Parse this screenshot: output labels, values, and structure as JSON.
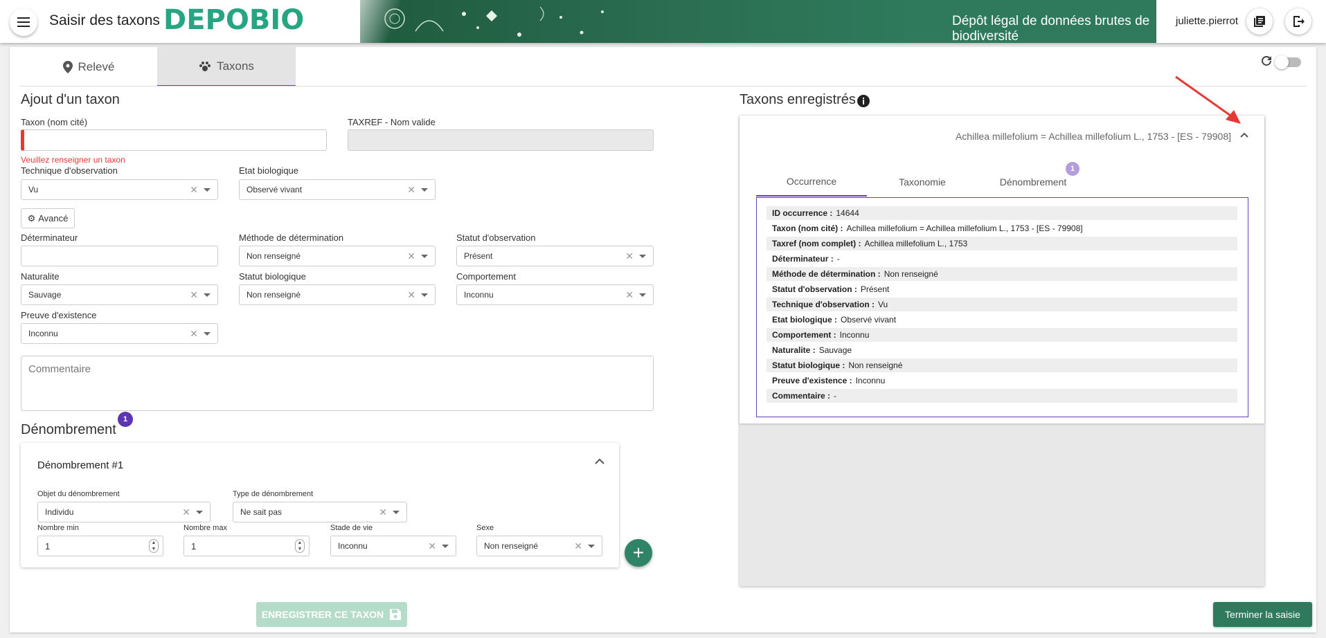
{
  "header": {
    "app_title": "Saisir des taxons",
    "logo_text": "DEPOBIO",
    "banner_title": "Dépôt légal de données brutes de biodiversité",
    "username": "juliette.pierrot",
    "menu_icon": "menu-icon",
    "docs_icon": "library-books-icon",
    "logout_icon": "logout-icon"
  },
  "tabs": [
    {
      "label": "Relevé",
      "icon": "map-marker-icon",
      "active": false
    },
    {
      "label": "Taxons",
      "icon": "paw-icon",
      "active": true
    }
  ],
  "form": {
    "section_title": "Ajout d'un taxon",
    "taxon_label": "Taxon (nom cité)",
    "taxon_value": "",
    "taxref_label": "TAXREF - Nom valide",
    "error_text": "Veuillez renseigner un taxon",
    "technique_label": "Technique d'observation",
    "technique_value": "Vu",
    "etat_label": "Etat biologique",
    "etat_value": "Observé vivant",
    "advanced_label": "Avancé",
    "determinateur_label": "Déterminateur",
    "methode_label": "Méthode de détermination",
    "methode_value": "Non renseigné",
    "statut_obs_label": "Statut d'observation",
    "statut_obs_value": "Présent",
    "naturalite_label": "Naturalite",
    "naturalite_value": "Sauvage",
    "statut_bio_label": "Statut biologique",
    "statut_bio_value": "Non renseigné",
    "comportement_label": "Comportement",
    "comportement_value": "Inconnu",
    "preuve_label": "Preuve d'existence",
    "preuve_value": "Inconnu",
    "comment_placeholder": "Commentaire"
  },
  "denombrement": {
    "section_title": "Dénombrement",
    "badge": "1",
    "card_title": "Dénombrement #1",
    "objet_label": "Objet du dénombrement",
    "objet_value": "Individu",
    "type_label": "Type de dénombrement",
    "type_value": "Ne sait pas",
    "min_label": "Nombre min",
    "min_value": "1",
    "max_label": "Nombre max",
    "max_value": "1",
    "stade_label": "Stade de vie",
    "stade_value": "Inconnu",
    "sexe_label": "Sexe",
    "sexe_value": "Non renseigné"
  },
  "actions": {
    "save_label": "ENREGISTRER CE TAXON",
    "finish_label": "Terminer la saisie"
  },
  "registered": {
    "title": "Taxons enregistrés",
    "taxon_header": "Achillea millefolium = Achillea millefolium L., 1753 - [ES - 79908]",
    "tabs": [
      "Occurrence",
      "Taxonomie",
      "Dénombrement"
    ],
    "denombrement_badge": "1",
    "details": [
      {
        "label": "ID occurrence :",
        "value": "14644"
      },
      {
        "label": "Taxon (nom cité) :",
        "value": "Achillea millefolium = Achillea millefolium L., 1753 - [ES - 79908]"
      },
      {
        "label": "Taxref (nom complet) :",
        "value": "Achillea millefolium L., 1753"
      },
      {
        "label": "Déterminateur :",
        "value": "-"
      },
      {
        "label": "Méthode de détermination :",
        "value": "Non renseigné"
      },
      {
        "label": "Statut d'observation :",
        "value": "Présent"
      },
      {
        "label": "Technique d'observation :",
        "value": "Vu"
      },
      {
        "label": "Etat biologique :",
        "value": "Observé vivant"
      },
      {
        "label": "Comportement :",
        "value": "Inconnu"
      },
      {
        "label": "Naturalite :",
        "value": "Sauvage"
      },
      {
        "label": "Statut biologique :",
        "value": "Non renseigné"
      },
      {
        "label": "Preuve d'existence :",
        "value": "Inconnu"
      },
      {
        "label": "Commentaire :",
        "value": "-"
      }
    ]
  },
  "colors": {
    "primary_green": "#2f7a5c",
    "logo_green": "#27a583",
    "accent_purple": "#6a3fb5",
    "error_red": "#e53935",
    "annotation_arrow": "#e53935"
  }
}
